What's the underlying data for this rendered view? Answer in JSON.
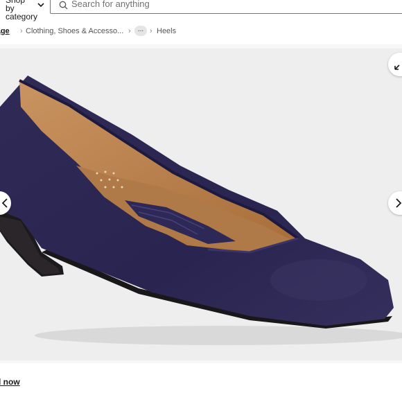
{
  "header": {
    "shop_by_category": "Shop by category",
    "search_placeholder": "Search for anything"
  },
  "breadcrumb": {
    "home": "page",
    "category": "Clothing, Shoes & Accesso...",
    "more": "...",
    "current": "Heels"
  },
  "gallery": {
    "image_icon": "shoe-product-photo",
    "prev_icon": "chevron-left-icon",
    "next_icon": "chevron-right-icon",
    "expand_icon": "expand-icon"
  },
  "footer": {
    "link": "l now"
  },
  "colors": {
    "shoe_navy": "#2b2550",
    "lining_tan": "#b9834f",
    "heel_black": "#1d1a1d"
  }
}
